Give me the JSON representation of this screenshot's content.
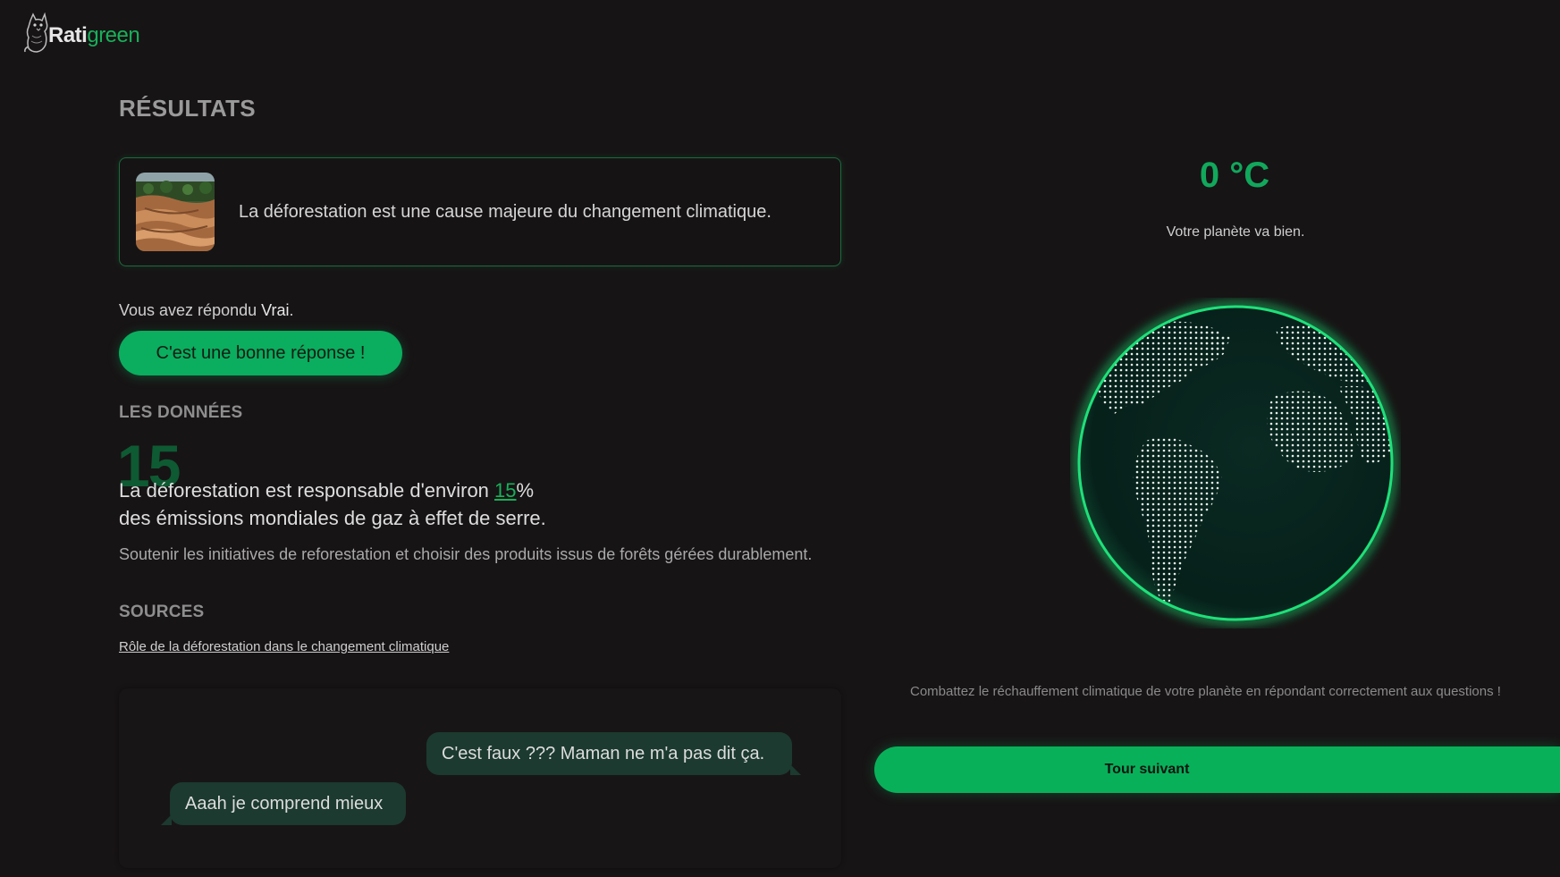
{
  "header": {
    "logo_text_a": "Rati",
    "logo_text_b": "green",
    "logo_icon": "cat-icon"
  },
  "results": {
    "title": "RÉSULTATS",
    "question": {
      "image": "deforestation-thumbnail",
      "text": "La déforestation est une cause majeure du changement climatique."
    },
    "answer_prefix": "Vous avez répondu ",
    "answer_value": "Vrai",
    "answer_suffix": ".",
    "verdict": "C'est une bonne réponse !"
  },
  "data_section": {
    "title": "LES DONNÉES",
    "big_number": "15",
    "stat_before": "La déforestation est responsable d'environ ",
    "stat_number": "15",
    "stat_after_line1": "%",
    "stat_line2": "des émissions mondiales de gaz à effet de serre.",
    "tip": "Soutenir les initiatives de reforestation et choisir des produits issus de forêts gérées durablement."
  },
  "sources": {
    "title": "SOURCES",
    "link": "Rôle de la déforestation dans le changement climatique"
  },
  "chat": {
    "messages": [
      {
        "side": "right",
        "text": "C'est faux ??? Maman ne m'a pas dit ça."
      },
      {
        "side": "left",
        "text": "Aaah je comprend mieux"
      }
    ]
  },
  "planet": {
    "temperature": "0 °C",
    "status": "Votre planète va bien.",
    "globe_icon": "earth-globe-icon",
    "hint": "Combattez le réchauffement climatique de votre planète en répondant correctement aux questions !",
    "next_button": "Tour suivant"
  },
  "colors": {
    "accent": "#0bad5e",
    "background": "#171415",
    "bubble": "#1c3a2f"
  }
}
